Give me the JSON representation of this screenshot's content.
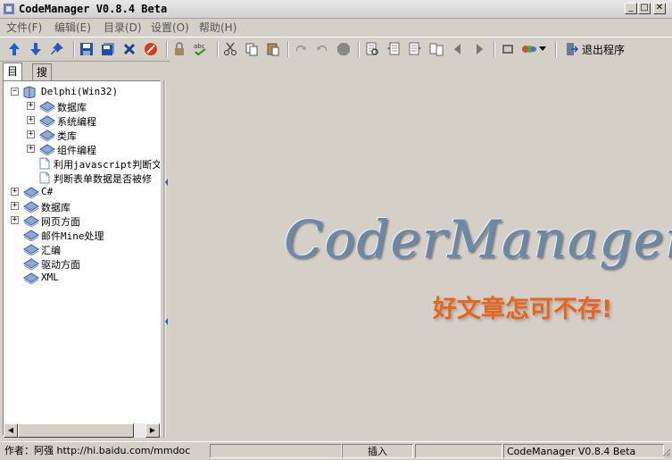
{
  "window": {
    "title": "CodeManager V0.8.4 Beta",
    "min": "_",
    "max": "□",
    "close": "✕"
  },
  "menu": [
    "文件(F)",
    "编辑(E)",
    "目录(D)",
    "设置(O)",
    "帮助(H)"
  ],
  "toolbar": {
    "exit_label": "退出程序"
  },
  "tabs": [
    "目录",
    "搜索"
  ],
  "tree": [
    {
      "label": "Delphi(Win32)",
      "expander": "−",
      "icon": "book-icon"
    },
    {
      "label": "数据库",
      "expander": "+",
      "icon": "folder-diamond-icon"
    },
    {
      "label": "系统编程",
      "expander": "+",
      "icon": "folder-diamond-icon"
    },
    {
      "label": "类库",
      "expander": "+",
      "icon": "folder-diamond-icon"
    },
    {
      "label": "组件编程",
      "expander": "+",
      "icon": "folder-diamond-icon"
    },
    {
      "label": "利用javascript判断文",
      "expander": "",
      "icon": "document-icon"
    },
    {
      "label": "判断表单数据是否被修",
      "expander": "",
      "icon": "document-icon"
    },
    {
      "label": "C#",
      "expander": "+",
      "icon": "folder-diamond-icon"
    },
    {
      "label": "数据库",
      "expander": "+",
      "icon": "folder-diamond-icon"
    },
    {
      "label": "网页方面",
      "expander": "+",
      "icon": "folder-diamond-icon"
    },
    {
      "label": "邮件Mine处理",
      "expander": "",
      "icon": "folder-diamond-icon"
    },
    {
      "label": "汇编",
      "expander": "",
      "icon": "folder-diamond-icon"
    },
    {
      "label": "驱动方面",
      "expander": "",
      "icon": "folder-diamond-icon"
    },
    {
      "label": "XML",
      "expander": "",
      "icon": "folder-diamond-icon"
    }
  ],
  "main": {
    "logo": "CoderManager",
    "slogan": "好文章怎可不存!"
  },
  "status": {
    "author": "作者：阿强 http://hi.baidu.com/mmdoc",
    "mode": "插入",
    "version": "CodeManager V0.8.4 Beta"
  },
  "colors": {
    "slogan": "#e8651a",
    "logo": "#6a88a8",
    "background": "#d4d0c8"
  }
}
